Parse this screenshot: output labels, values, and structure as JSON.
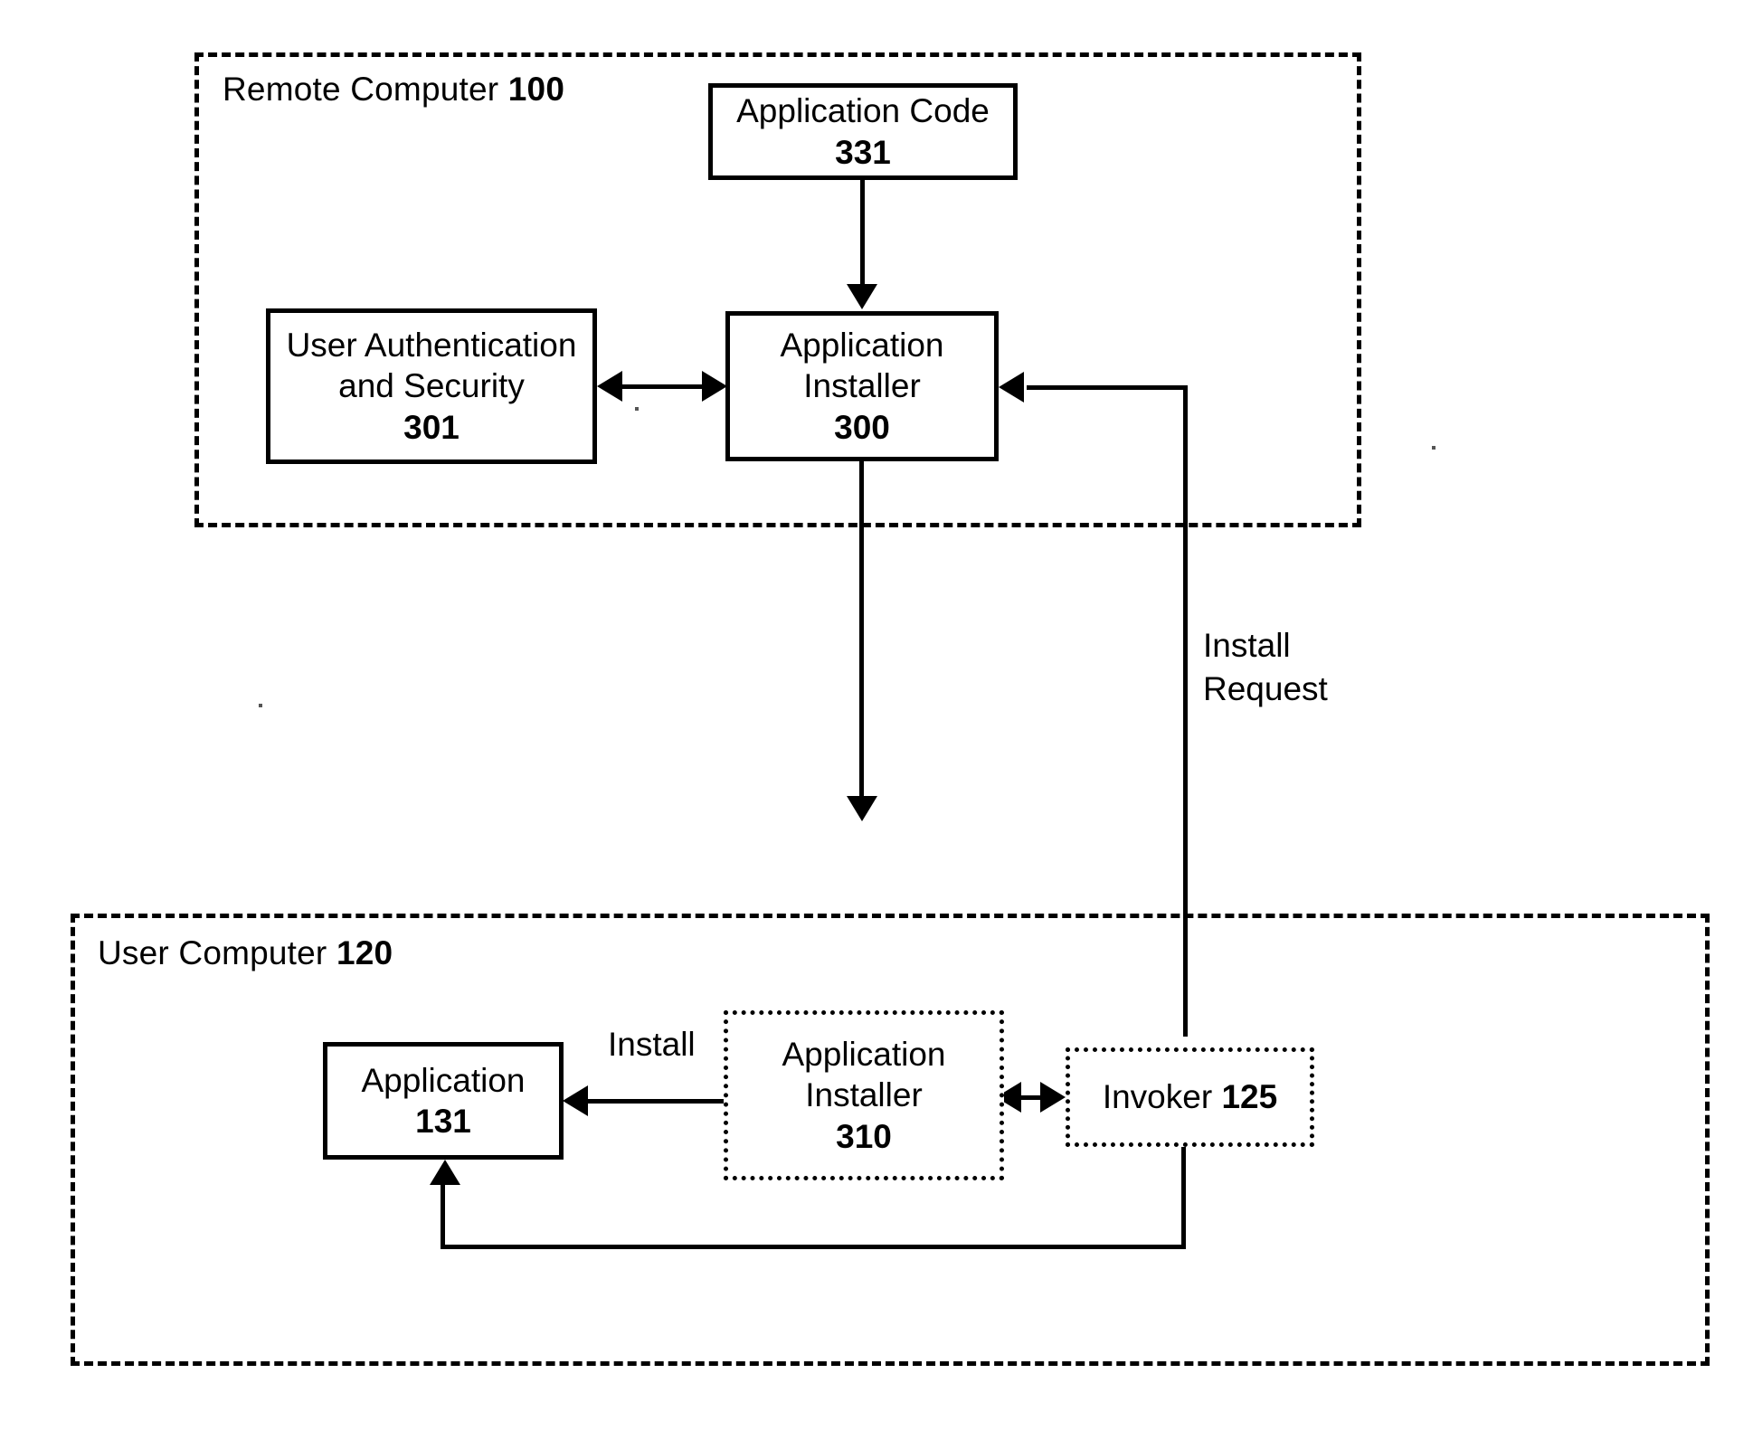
{
  "figure": {
    "type": "block-diagram",
    "background": "#ffffff",
    "stroke": "#000000"
  },
  "groups": [
    {
      "id": "remote-computer",
      "label_text": "Remote Computer ",
      "label_ref": "100"
    },
    {
      "id": "user-computer",
      "label_text": "User Computer ",
      "label_ref": "120"
    }
  ],
  "boxes": [
    {
      "id": "application-code",
      "lines": [
        "Application Code"
      ],
      "ref": "331",
      "border": "solid"
    },
    {
      "id": "user-authentication-and-security",
      "lines": [
        "User Authentication",
        "and Security"
      ],
      "ref": "301",
      "border": "solid"
    },
    {
      "id": "application-installer-remote",
      "lines": [
        "Application",
        "Installer"
      ],
      "ref": "300",
      "border": "solid"
    },
    {
      "id": "application-installer-user",
      "lines": [
        "Application",
        "Installer"
      ],
      "ref": "310",
      "border": "dotted"
    },
    {
      "id": "application",
      "lines": [
        "Application"
      ],
      "ref": "131",
      "border": "solid"
    },
    {
      "id": "invoker",
      "lines": [
        "Invoker "
      ],
      "ref": "125",
      "border": "dotted",
      "inline_ref": true
    }
  ],
  "edge_labels": {
    "install_request_line1": "Install",
    "install_request_line2": "Request",
    "install": "Install"
  }
}
